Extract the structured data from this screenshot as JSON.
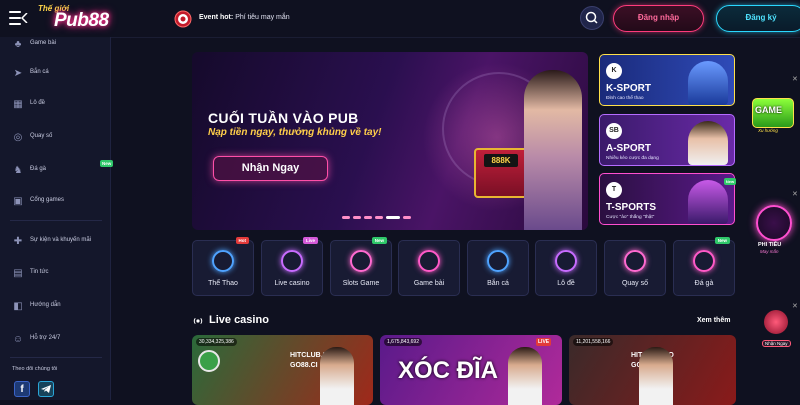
{
  "header": {
    "logo_text": "Pub88",
    "logo_small": "Thế giới",
    "ticker_prefix": "Event hot:",
    "ticker_text": "Phí tiêu may mắn",
    "login_label": "Đăng nhập",
    "register_label": "Đăng ký"
  },
  "sidebar": {
    "items": [
      {
        "label": "Game bài",
        "icon": "cards-icon"
      },
      {
        "label": "Bắn cá",
        "icon": "fish-icon"
      },
      {
        "label": "Lô đề",
        "icon": "lottery-icon"
      },
      {
        "label": "Quay số",
        "icon": "wheel-icon"
      },
      {
        "label": "Đá gà",
        "icon": "rooster-icon",
        "badge": "New"
      },
      {
        "label": "Cổng games",
        "icon": "grid-icon"
      },
      {
        "label": "Sự kiện và khuyến mãi",
        "icon": "gift-icon"
      },
      {
        "label": "Tin tức",
        "icon": "news-icon"
      },
      {
        "label": "Hướng dẫn",
        "icon": "guide-icon"
      },
      {
        "label": "Hỗ trợ 24/7",
        "icon": "support-icon"
      }
    ],
    "follow_title": "Theo dõi chúng tôi"
  },
  "hero": {
    "title": "CUỐI TUẦN VÀO PUB",
    "subtitle": "Nạp tiền ngay, thưởng khủng về tay!",
    "button_label": "Nhận Ngay",
    "chest_label": "888K"
  },
  "sports": [
    {
      "name": "K-SPORT",
      "desc": "Đỉnh cao thể thao",
      "logo": "K"
    },
    {
      "name": "A-SPORT",
      "desc": "Nhiều kèo cược đa dạng",
      "logo": "SB"
    },
    {
      "name": "T-SPORTS",
      "desc": "Cược \"ảo\" thắng \"thật\"",
      "logo": "T",
      "badge": "New"
    }
  ],
  "floating": {
    "game_label": "GAME",
    "game_sub": "Xu hướng",
    "wheel_label": "PHI TIÊU",
    "wheel_sub": "May mắn",
    "reward_label": "Nhận Ngay"
  },
  "categories": [
    {
      "label": "Thể Thao",
      "badge": "Hot",
      "badge_color": "#e23a3a",
      "icon": "soccer-ball-icon",
      "icon_color": "#4fa3ff"
    },
    {
      "label": "Live casino",
      "badge": "Live",
      "badge_color": "#d45ad8",
      "icon": "broadcast-icon",
      "icon_color": "#c86cff"
    },
    {
      "label": "Slots Game",
      "badge": "New",
      "badge_color": "#2fc86a",
      "icon": "slot-machine-icon",
      "icon_color": "#ff6ad0"
    },
    {
      "label": "Game bài",
      "badge": "",
      "badge_color": "",
      "icon": "cards-icon",
      "icon_color": "#ff5ac8"
    },
    {
      "label": "Bắn cá",
      "badge": "",
      "badge_color": "",
      "icon": "shark-icon",
      "icon_color": "#4fa3ff"
    },
    {
      "label": "Lô đề",
      "badge": "",
      "badge_color": "",
      "icon": "lottery-ball-icon",
      "icon_color": "#c86cff"
    },
    {
      "label": "Quay số",
      "badge": "",
      "badge_color": "",
      "icon": "wheel-icon",
      "icon_color": "#ff6ad0"
    },
    {
      "label": "Đá gà",
      "badge": "New",
      "badge_color": "#2fc86a",
      "icon": "rooster-icon",
      "icon_color": "#ff5ac8"
    }
  ],
  "live": {
    "title": "Live casino",
    "see_more": "Xem thêm",
    "cards": [
      {
        "amount": "30,334,325,386",
        "brand1": "HITCLUB.SO",
        "brand2": "GO88.CI",
        "big": "",
        "live_tag": ""
      },
      {
        "amount": "1,675,843,692",
        "brand1": "",
        "brand2": "",
        "big": "XÓC ĐĨA",
        "live_tag": "LIVE"
      },
      {
        "amount": "11,201,558,166",
        "brand1": "HITCLUB.SO",
        "brand2": "GO88.CI",
        "big": "",
        "live_tag": ""
      }
    ]
  }
}
